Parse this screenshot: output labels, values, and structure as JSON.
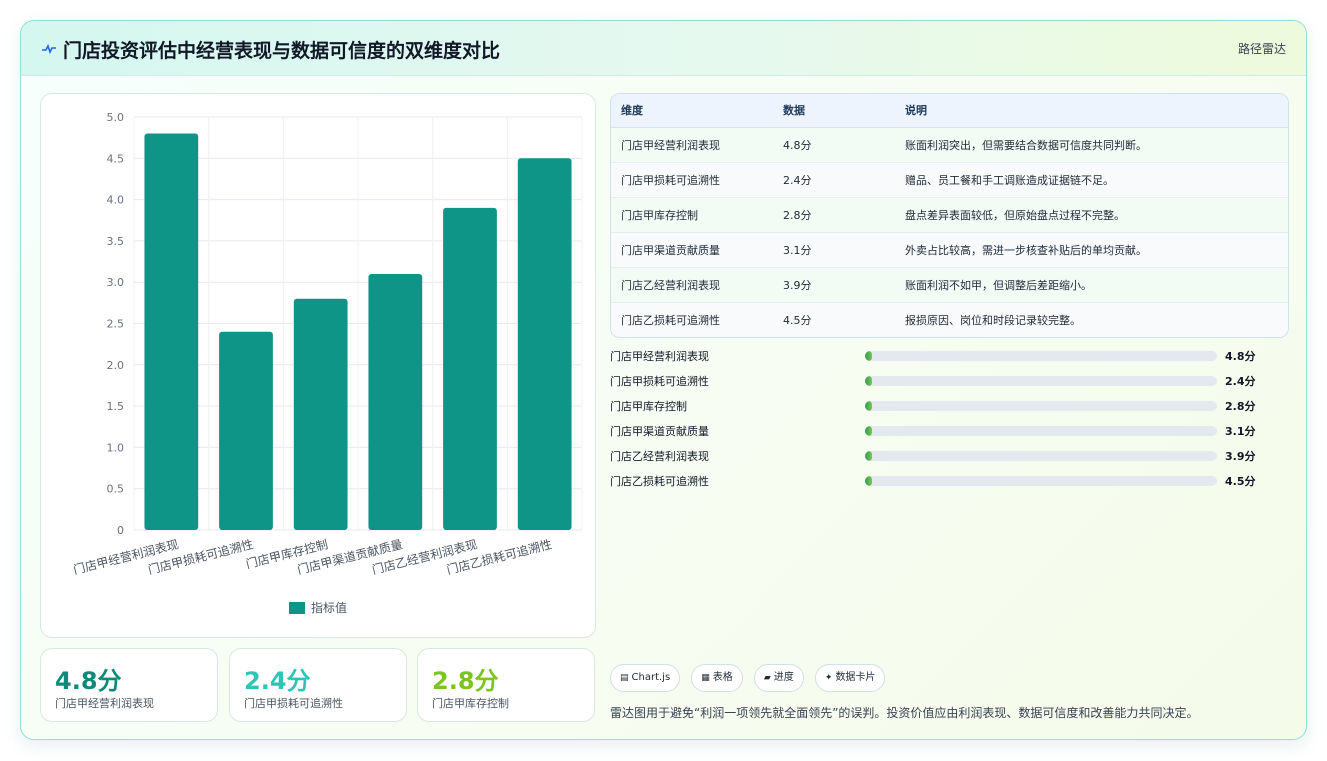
{
  "header": {
    "title": "门店投资评估中经营表现与数据可信度的双维度对比",
    "right_label": "路径雷达",
    "icon": "pulse-icon"
  },
  "chart_data": {
    "type": "bar",
    "categories": [
      "门店甲经营利润表现",
      "门店甲损耗可追溯性",
      "门店甲库存控制",
      "门店甲渠道贡献质量",
      "门店乙经营利润表现",
      "门店乙损耗可追溯性"
    ],
    "series": [
      {
        "name": "指标值",
        "values": [
          4.8,
          2.4,
          2.8,
          3.1,
          3.9,
          4.5
        ]
      }
    ],
    "ylim": [
      0,
      5.0
    ],
    "yticks": [
      "0",
      "0.5",
      "1.0",
      "1.5",
      "2.0",
      "2.5",
      "3.0",
      "3.5",
      "4.0",
      "4.5",
      "5.0"
    ],
    "grid": true,
    "legend": "bottom",
    "color": "#0f9488"
  },
  "kpis": [
    {
      "value": "4.8分",
      "label": "门店甲经营利润表现",
      "color": "#0f8a7a"
    },
    {
      "value": "2.4分",
      "label": "门店甲损耗可追溯性",
      "color": "#2ec4b6"
    },
    {
      "value": "2.8分",
      "label": "门店甲库存控制",
      "color": "#7cc520"
    }
  ],
  "table": {
    "headers": [
      "维度",
      "数据",
      "说明"
    ],
    "rows": [
      [
        "门店甲经营利润表现",
        "4.8分",
        "账面利润突出，但需要结合数据可信度共同判断。"
      ],
      [
        "门店甲损耗可追溯性",
        "2.4分",
        "赠品、员工餐和手工调账造成证据链不足。"
      ],
      [
        "门店甲库存控制",
        "2.8分",
        "盘点差异表面较低，但原始盘点过程不完整。"
      ],
      [
        "门店甲渠道贡献质量",
        "3.1分",
        "外卖占比较高，需进一步核查补贴后的单均贡献。"
      ],
      [
        "门店乙经营利润表现",
        "3.9分",
        "账面利润不如甲，但调整后差距缩小。"
      ],
      [
        "门店乙损耗可追溯性",
        "4.5分",
        "报损原因、岗位和时段记录较完整。"
      ]
    ]
  },
  "progress": [
    {
      "label": "门店甲经营利润表现",
      "value": "4.8分",
      "fraction": 0.02
    },
    {
      "label": "门店甲损耗可追溯性",
      "value": "2.4分",
      "fraction": 0.02
    },
    {
      "label": "门店甲库存控制",
      "value": "2.8分",
      "fraction": 0.02
    },
    {
      "label": "门店甲渠道贡献质量",
      "value": "3.1分",
      "fraction": 0.02
    },
    {
      "label": "门店乙经营利润表现",
      "value": "3.9分",
      "fraction": 0.02
    },
    {
      "label": "门店乙损耗可追溯性",
      "value": "4.5分",
      "fraction": 0.02
    }
  ],
  "tags": [
    {
      "icon": "chart-icon",
      "glyph": "▤",
      "label": "Chart.js"
    },
    {
      "icon": "table-icon",
      "glyph": "▦",
      "label": "表格"
    },
    {
      "icon": "progress-icon",
      "glyph": "▰",
      "label": "进度"
    },
    {
      "icon": "sparkle-icon",
      "glyph": "✦",
      "label": "数据卡片"
    }
  ],
  "footnote": "雷达图用于避免“利润一项领先就全面领先”的误判。投资价值应由利润表现、数据可信度和改善能力共同决定。"
}
